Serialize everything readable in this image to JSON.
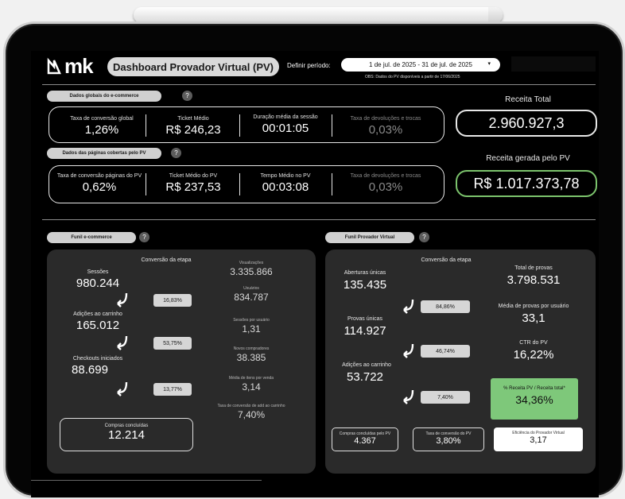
{
  "header": {
    "logo_text": "mk",
    "title": "Dashboard Provador Virtual (PV)",
    "period_label": "Definir período:",
    "period_value": "1 de jul. de 2025 - 31 de jul. de 2025",
    "period_chevron": "▾",
    "obs": "OBS: Dados do PV disponíveis a partir de 17/06/2025"
  },
  "global": {
    "section_label": "Dados globais do e-commerce",
    "help": "?",
    "kpis": [
      {
        "label": "Taxa de conversão global",
        "value": "1,26%"
      },
      {
        "label": "Ticket Médio",
        "value": "R$ 246,23"
      },
      {
        "label": "Duração média da sessão",
        "value": "00:01:05"
      },
      {
        "label": "Taxa de devoluções e trocas",
        "value": "0,03%"
      }
    ],
    "total_label": "Receita Total",
    "total_value": "2.960.927,3"
  },
  "pages": {
    "section_label": "Dados das páginas cobertas pelo PV",
    "help": "?",
    "kpis": [
      {
        "label": "Taxa de conversão páginas do PV",
        "value": "0,62%"
      },
      {
        "label": "Ticket Médio do PV",
        "value": "R$ 237,53"
      },
      {
        "label": "Tempo Médio no PV",
        "value": "00:03:08"
      },
      {
        "label": "Taxa de devoluções e trocas",
        "value": "0,03%"
      }
    ],
    "pv_label": "Receita gerada pelo PV",
    "pv_value": "R$ 1.017.373,78"
  },
  "funnel_ecom": {
    "section_label": "Funil e-commerce",
    "help": "?",
    "stage_header": "Conversão da etapa",
    "steps": [
      {
        "label": "Sessões",
        "value": "980.244"
      },
      {
        "label": "Adições ao carrinho",
        "value": "165.012"
      },
      {
        "label": "Checkouts iniciados",
        "value": "88.699"
      }
    ],
    "rates": [
      "16,83%",
      "53,75%",
      "13,77%"
    ],
    "final_label": "Compras concluídas",
    "final_value": "12.214",
    "stats": [
      {
        "label": "Visualizações",
        "value": "3.335.866"
      },
      {
        "label": "Usuários",
        "value": "834.787"
      },
      {
        "label": "Sessões por usuário",
        "value": "1,31"
      },
      {
        "label": "Novos compradores",
        "value": "38.385"
      },
      {
        "label": "Média de itens por venda",
        "value": "3,14"
      },
      {
        "label": "Taxa de conversão de add ao carrinho",
        "value": "7,40%"
      }
    ]
  },
  "funnel_pv": {
    "section_label": "Funil Provador Virtual",
    "help": "?",
    "stage_header": "Conversão da etapa",
    "steps": [
      {
        "label": "Aberturas únicas",
        "value": "135.435"
      },
      {
        "label": "Provas únicas",
        "value": "114.927"
      },
      {
        "label": "Adições ao carrinho",
        "value": "53.722"
      }
    ],
    "rates": [
      "84,86%",
      "46,74%",
      "7,40%"
    ],
    "right": [
      {
        "label": "Total de provas",
        "value": "3.798.531"
      },
      {
        "label": "Média de provas por usuário",
        "value": "33,1"
      },
      {
        "label": "CTR do PV",
        "value": "16,22%"
      }
    ],
    "highlight_label": "% Receita PV / Receita total*",
    "highlight_value": "34,36%",
    "highlight_color": "#7ec87a",
    "bottom": [
      {
        "label": "Compras concluídas pelo PV",
        "value": "4.367"
      },
      {
        "label": "Taxa de conversão do PV",
        "value": "3,80%"
      },
      {
        "label": "Eficiência do Provador Virtual",
        "value": "3,17"
      }
    ]
  }
}
